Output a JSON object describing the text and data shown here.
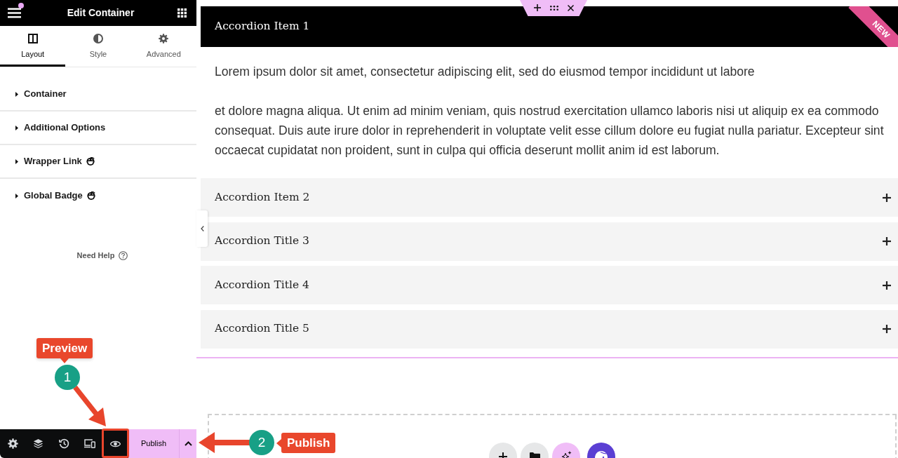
{
  "panel": {
    "title": "Edit Container",
    "tabs": [
      {
        "label": "Layout",
        "selected": true
      },
      {
        "label": "Style",
        "selected": false
      },
      {
        "label": "Advanced",
        "selected": false
      }
    ],
    "sections": [
      {
        "label": "Container",
        "expanded": false,
        "badge": false
      },
      {
        "label": "Additional Options",
        "expanded": false,
        "badge": false
      },
      {
        "label": "Wrapper Link",
        "expanded": false,
        "badge": true
      },
      {
        "label": "Global Badge",
        "expanded": false,
        "badge": true
      }
    ],
    "help": "Need Help"
  },
  "bottom_bar": {
    "publish": "Publish"
  },
  "canvas": {
    "ribbon": "NEW",
    "accordion": [
      {
        "title": "Accordion Item 1",
        "expanded": true,
        "paragraphs": [
          "Lorem ipsum dolor sit amet, consectetur adipiscing elit, sed do eiusmod tempor incididunt ut labore",
          "et dolore magna aliqua. Ut enim ad minim veniam, quis nostrud exercitation ullamco laboris nisi ut aliquip ex ea commodo consequat. Duis aute irure dolor in reprehenderit in voluptate velit esse cillum dolore eu fugiat nulla pariatur. Excepteur sint occaecat cupidatat non proident, sunt in culpa qui officia deserunt mollit anim id est laborum."
        ]
      },
      {
        "title": "Accordion Item 2",
        "expanded": false
      },
      {
        "title": "Accordion Title 3",
        "expanded": false
      },
      {
        "title": "Accordion Title 4",
        "expanded": false
      },
      {
        "title": "Accordion Title 5",
        "expanded": false
      }
    ]
  },
  "annotations": [
    {
      "label": "Preview",
      "number": "1"
    },
    {
      "label": "Publish",
      "number": "2"
    }
  ]
}
